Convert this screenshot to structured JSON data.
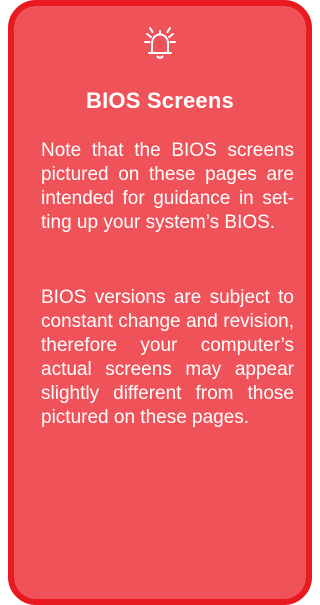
{
  "note": {
    "icon": "bell-alert-icon",
    "title": "BIOS Screens",
    "paragraph_1": "Note that the BIOS screens pictured on these pages are intend­ed for guidance in set­ting up your system’s BIOS.",
    "paragraph_2": "BIOS versions are sub­ject to constant change and revision, therefore your computer’s actual screens may appear slightly different from those pictured on these pages."
  },
  "colors": {
    "box_fill": "#f0525a",
    "box_border": "#e8191f",
    "text": "#ffffff"
  }
}
